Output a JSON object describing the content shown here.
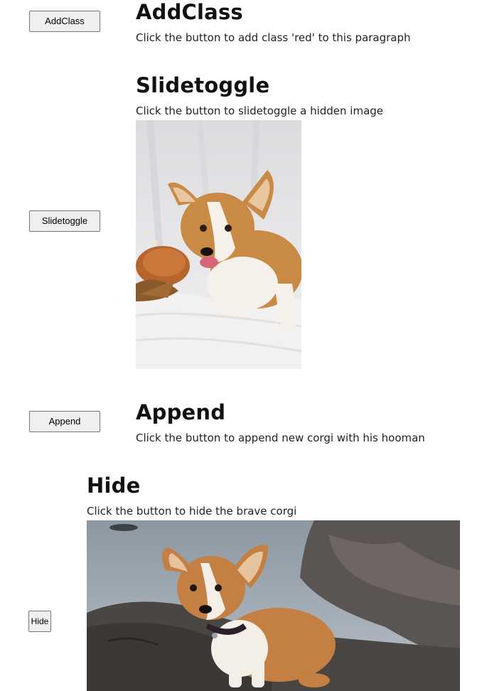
{
  "sections": {
    "addclass": {
      "button_label": "AddClass",
      "title": "AddClass",
      "text": "Click the button to add class 'red' to this paragraph"
    },
    "slidetoggle": {
      "button_label": "Slidetoggle",
      "title": "Slidetoggle",
      "text": "Click the button to slidetoggle a hidden image"
    },
    "append": {
      "button_label": "Append",
      "title": "Append",
      "text": "Click the button to append new corgi with his hooman"
    },
    "hide": {
      "button_label": "Hide",
      "title": "Hide",
      "text": "Click the button to hide the brave corgi"
    }
  },
  "colors": {
    "button_bg": "#efefef",
    "button_border": "#767676",
    "corgi_orange": "#c98a45",
    "corgi_white": "#f5f1ea"
  }
}
